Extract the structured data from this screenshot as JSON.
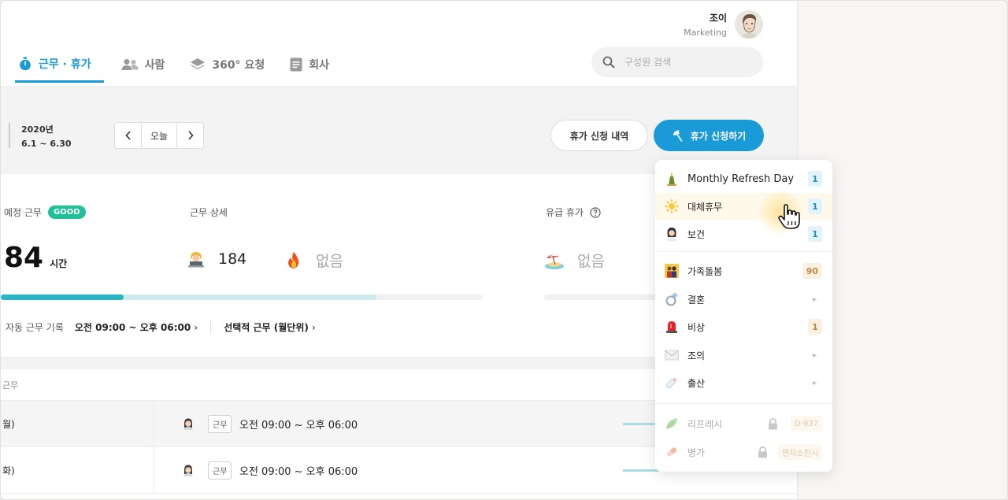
{
  "user": {
    "name": "조이",
    "department": "Marketing"
  },
  "nav": {
    "tabs": [
      {
        "label": "근무 · 휴가",
        "icon": "stopwatch-icon",
        "active": true
      },
      {
        "label": "사람",
        "icon": "people-icon"
      },
      {
        "label": "360° 요청",
        "icon": "layers-icon"
      },
      {
        "label": "회사",
        "icon": "document-icon"
      }
    ],
    "search_placeholder": "구성원 검색"
  },
  "period": {
    "year": "2020년",
    "range": "6.1 ~ 6.30",
    "today_label": "오늘"
  },
  "actions": {
    "history_label": "휴가 신청 내역",
    "apply_label": "휴가 신청하기"
  },
  "summary": {
    "scheduled_label": "예정 근무",
    "good_badge": "GOOD",
    "hours_value": "84",
    "hours_unit": "시간",
    "detail_label": "근무 상세",
    "work_count": "184",
    "overtime_value": "없음",
    "paid_leave_label": "유급 휴가",
    "paid_leave_value": "없음",
    "auto_record_label": "자동 근무 기록",
    "auto_record_value": "오전 09:00 ~ 오후 06:00",
    "flex_label": "선택적 근무 (월단위)",
    "progress_fill": 0.255,
    "progress_secondary": 0.78
  },
  "list": {
    "header": "근무",
    "rows": [
      {
        "day": "월)",
        "tag": "근무",
        "time": "오전 09:00 ~ 오후 06:00"
      },
      {
        "day": "화)",
        "tag": "근무",
        "time": "오전 09:00 ~ 오후 06:00"
      }
    ]
  },
  "leave_menu": {
    "items": [
      {
        "label": "Monthly Refresh Day",
        "icon": "candle-icon",
        "badge": "1",
        "badge_style": "blue"
      },
      {
        "label": "대체휴무",
        "icon": "sun-icon",
        "badge": "1",
        "badge_style": "blue"
      },
      {
        "label": "보건",
        "icon": "woman-icon",
        "badge": "1",
        "badge_style": "blue"
      },
      {
        "label": "가족돌봄",
        "icon": "family-icon",
        "badge": "90",
        "badge_style": "orange"
      },
      {
        "label": "결혼",
        "icon": "ring-icon",
        "badge": "",
        "badge_style": "chevron"
      },
      {
        "label": "비상",
        "icon": "siren-icon",
        "badge": "1",
        "badge_style": "orange"
      },
      {
        "label": "조의",
        "icon": "envelope-icon",
        "badge": "",
        "badge_style": "chevron"
      },
      {
        "label": "출산",
        "icon": "baby-bottle-icon",
        "badge": "",
        "badge_style": "chevron"
      },
      {
        "label": "리프레시",
        "icon": "leaf-icon",
        "badge": "D-937",
        "badge_style": "locked"
      },
      {
        "label": "병가",
        "icon": "pill-icon",
        "badge": "연차소진시",
        "badge_style": "locked"
      }
    ]
  },
  "colors": {
    "accent": "#1a9ad6",
    "good": "#20c19a",
    "progress": "#29b5c4",
    "progress_track": "#cfeaed"
  }
}
